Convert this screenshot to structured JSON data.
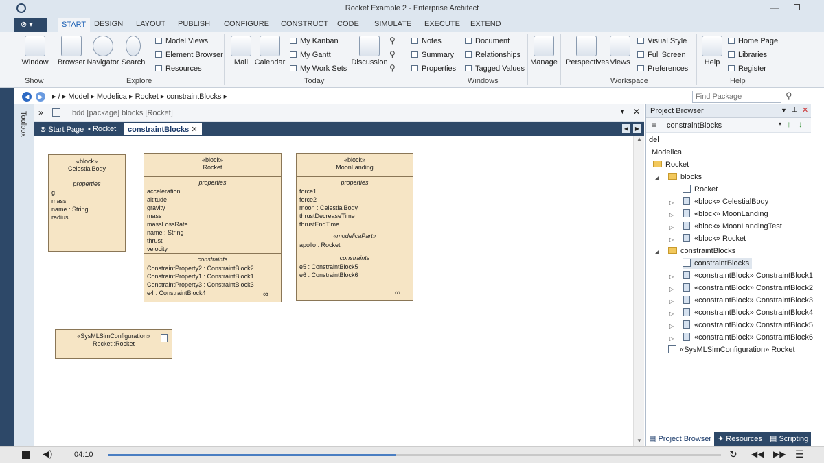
{
  "app": {
    "title": "Rocket Example 2 - Enterprise Architect"
  },
  "menu_tabs": [
    "START",
    "DESIGN",
    "LAYOUT",
    "PUBLISH",
    "CONFIGURE",
    "CONSTRUCT",
    "CODE",
    "SIMULATE",
    "EXECUTE",
    "EXTEND"
  ],
  "active_menu": "START",
  "ribbon": {
    "big_buttons": [
      "Window",
      "Browser",
      "Navigator",
      "Search",
      "Mail",
      "Calendar",
      "Discussion",
      "Manage",
      "Perspectives",
      "Views",
      "Help"
    ],
    "explore_items": [
      "Model Views",
      "Element Browser",
      "Resources"
    ],
    "today_items": [
      "My Kanban",
      "My Gantt",
      "My Work Sets"
    ],
    "windows_col1": [
      "Notes",
      "Summary",
      "Properties"
    ],
    "windows_col2": [
      "Document",
      "Relationships",
      "Tagged Values"
    ],
    "workspace_items": [
      "Visual Style",
      "Full Screen",
      "Preferences"
    ],
    "help_items": [
      "Home Page",
      "Libraries",
      "Register"
    ],
    "groups": [
      "Show",
      "Explore",
      "Today",
      "Windows",
      "Workspace",
      "Help"
    ]
  },
  "breadcrumb": [
    "/",
    "Model",
    "Modelica",
    "Rocket",
    "constraintBlocks"
  ],
  "find_placeholder": "Find Package",
  "toolbox_label": "Toolbox",
  "diagram": {
    "header": "bdd [package] blocks [Rocket]",
    "tabs": [
      "Start Page",
      "Rocket",
      "constraintBlocks"
    ],
    "active_tab": "constraintBlocks",
    "blocks": [
      {
        "stereo": "«block»",
        "name": "CelestialBody",
        "sections": [
          {
            "title": "properties",
            "items": [
              "g",
              "mass",
              "name : String",
              "radius"
            ]
          }
        ]
      },
      {
        "stereo": "«block»",
        "name": "Rocket",
        "sections": [
          {
            "title": "properties",
            "items": [
              "acceleration",
              "altitude",
              "gravity",
              "mass",
              "massLossRate",
              "name : String",
              "thrust",
              "velocity"
            ]
          },
          {
            "title": "constraints",
            "items": [
              "ConstraintProperty2 : ConstraintBlock2",
              "ConstraintProperty1 : ConstraintBlock1",
              "ConstraintProperty3 : ConstraintBlock3",
              "e4 : ConstraintBlock4"
            ]
          }
        ]
      },
      {
        "stereo": "«block»",
        "name": "MoonLanding",
        "sections": [
          {
            "title": "properties",
            "items": [
              "force1",
              "force2",
              "moon : CelestialBody",
              "thrustDecreaseTime",
              "thrustEndTime"
            ]
          },
          {
            "title": "«modelicaPart»",
            "items": [
              "apollo : Rocket"
            ]
          },
          {
            "title": "constraints",
            "items": [
              "e5 : ConstraintBlock5",
              "e6 : ConstraintBlock6"
            ]
          }
        ]
      },
      {
        "stereo": "«SysMLSimConfiguration»",
        "name": "Rocket::Rocket",
        "sections": []
      }
    ]
  },
  "project_browser": {
    "title": "Project Browser",
    "current": "constraintBlocks",
    "tree": [
      "del",
      "Modelica",
      "Rocket",
      "blocks",
      "Rocket",
      "«block» CelestialBody",
      "«block» MoonLanding",
      "«block» MoonLandingTest",
      "«block» Rocket",
      "constraintBlocks",
      "constraintBlocks",
      "«constraintBlock» ConstraintBlock1",
      "«constraintBlock» ConstraintBlock2",
      "«constraintBlock» ConstraintBlock3",
      "«constraintBlock» ConstraintBlock4",
      "«constraintBlock» ConstraintBlock5",
      "«constraintBlock» ConstraintBlock6",
      "«SysMLSimConfiguration» Rocket"
    ],
    "tabs": [
      "Project Browser",
      "Resources",
      "Scripting"
    ]
  },
  "player": {
    "time": "04:10",
    "progress": 0.47
  }
}
